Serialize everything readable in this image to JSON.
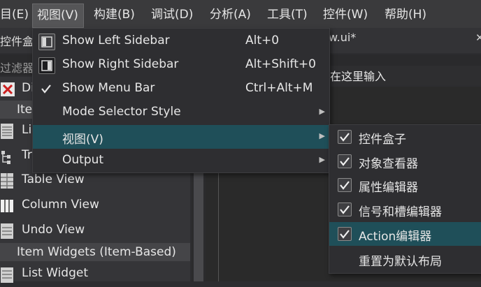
{
  "menubar": {
    "items": [
      "目(E)",
      "视图(V)",
      "构建(B)",
      "调试(D)",
      "分析(A)",
      "工具(T)",
      "控件(W)",
      "帮助(H)"
    ]
  },
  "doc": {
    "tab_text": "w.ui*",
    "left_title": "控件盒子",
    "filter_label": "过滤器",
    "editor_hint": "在这里输入"
  },
  "widgets": {
    "rows": [
      "Di",
      "List",
      "Tr",
      "Table View",
      "Column View",
      "Undo View",
      "List Widget"
    ],
    "categories": [
      "Ite",
      "Item Widgets (Item-Based)"
    ]
  },
  "view_menu": {
    "items": [
      {
        "label": "Show Left Sidebar",
        "shortcut": "Alt+0",
        "icon": "left-sidebar-icon"
      },
      {
        "label": "Show Right Sidebar",
        "shortcut": "Alt+Shift+0",
        "icon": "right-sidebar-icon"
      },
      {
        "label": "Show Menu Bar",
        "shortcut": "Ctrl+Alt+M",
        "icon": "checkmark-icon"
      },
      {
        "label": "Mode Selector Style",
        "shortcut": ""
      },
      {
        "label": "视图(V)",
        "shortcut": ""
      },
      {
        "label": "Output",
        "shortcut": ""
      }
    ]
  },
  "view_submenu": {
    "items": [
      {
        "label": "控件盒子",
        "checked": true
      },
      {
        "label": "对象查看器",
        "checked": true
      },
      {
        "label": "属性编辑器",
        "checked": true
      },
      {
        "label": "信号和槽编辑器",
        "checked": true
      },
      {
        "label": "Action编辑器",
        "checked": true
      },
      {
        "label": "重置为默认布局",
        "checked": false
      }
    ]
  },
  "colors": {
    "highlight": "#1f4f59",
    "menu_bg": "#2e2e31",
    "background": "#2d2d30"
  }
}
